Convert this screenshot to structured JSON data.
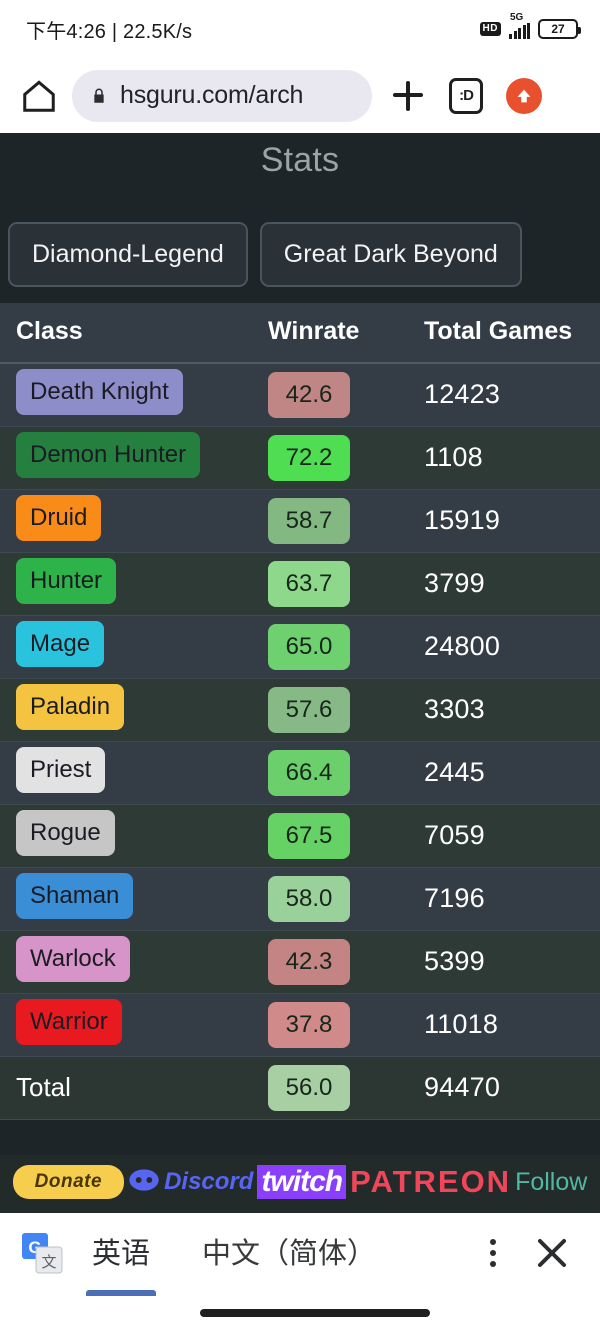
{
  "status_bar": {
    "time": "下午4:26 | 22.5K/s",
    "hd_label": "HD",
    "network": "5G",
    "battery": "27"
  },
  "browser": {
    "home_icon": "home-icon",
    "lock_icon": "lock-icon",
    "url": "hsguru.com/arch",
    "new_tab_icon": "plus-icon",
    "tab_count_label": ":D",
    "update_icon": "upload-arrow-icon"
  },
  "page": {
    "title": "Stats",
    "filters": [
      {
        "label": "Diamond-Legend"
      },
      {
        "label": "Great Dark Beyond"
      }
    ],
    "table": {
      "headers": [
        "Class",
        "Winrate",
        "Total Games"
      ],
      "rows": [
        {
          "class": "Death Knight",
          "class_bg": "#8d8dc9",
          "winrate": "42.6",
          "wr_bg": "#c08585",
          "games": "12423"
        },
        {
          "class": "Demon Hunter",
          "class_bg": "#25803f",
          "winrate": "72.2",
          "wr_bg": "#4fdd51",
          "games": "1108"
        },
        {
          "class": "Druid",
          "class_bg": "#f98b19",
          "winrate": "58.7",
          "wr_bg": "#83b883",
          "games": "15919"
        },
        {
          "class": "Hunter",
          "class_bg": "#2eb24a",
          "winrate": "63.7",
          "wr_bg": "#8ed88c",
          "games": "3799"
        },
        {
          "class": "Mage",
          "class_bg": "#2ac3dd",
          "winrate": "65.0",
          "wr_bg": "#6fd06f",
          "games": "24800"
        },
        {
          "class": "Paladin",
          "class_bg": "#f4c440",
          "winrate": "57.6",
          "wr_bg": "#86b986",
          "games": "3303"
        },
        {
          "class": "Priest",
          "class_bg": "#e2e2e2",
          "winrate": "66.4",
          "wr_bg": "#6bcf6b",
          "games": "2445"
        },
        {
          "class": "Rogue",
          "class_bg": "#c6c6c6",
          "winrate": "67.5",
          "wr_bg": "#66d265",
          "games": "7059"
        },
        {
          "class": "Shaman",
          "class_bg": "#3a8ed6",
          "winrate": "58.0",
          "wr_bg": "#9ad09a",
          "games": "7196"
        },
        {
          "class": "Warlock",
          "class_bg": "#d694c8",
          "winrate": "42.3",
          "wr_bg": "#c48484",
          "games": "5399"
        },
        {
          "class": "Warrior",
          "class_bg": "#e81a20",
          "winrate": "37.8",
          "wr_bg": "#d08a8a",
          "games": "11018"
        }
      ],
      "total": {
        "label": "Total",
        "winrate": "56.0",
        "wr_bg": "#a8cfa4",
        "games": "94470"
      }
    },
    "footer": {
      "donate": "Donate",
      "discord": "Discord",
      "twitch": "twitch",
      "patreon": "PATREON",
      "follow": "Follow"
    }
  },
  "translate_bar": {
    "icon": "google-translate-icon",
    "source_lang": "英语",
    "target_lang": "中文（简体）",
    "menu_icon": "kebab-menu-icon",
    "close_icon": "close-icon"
  },
  "colors": {
    "page_bg": "#1d2528",
    "row_odd": "#343d46",
    "row_even": "#2e3a35",
    "accent_blue": "#4a6fb5",
    "update_orange": "#e8502e"
  }
}
